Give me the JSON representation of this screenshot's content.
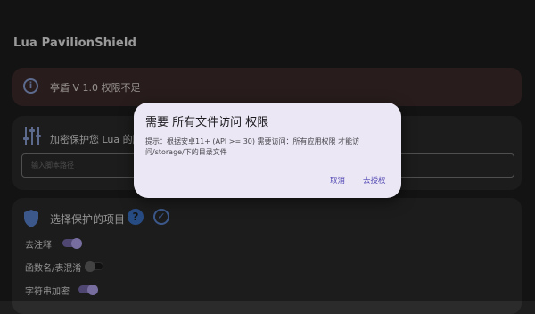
{
  "app": {
    "title": "Lua  PavilionShield"
  },
  "status": {
    "icon": "info-icon",
    "text": "亭盾  V 1.0  权限不足"
  },
  "encrypt": {
    "icon": "sliders-icon",
    "title": "加密保护您  Lua  的脚",
    "path_placeholder": "输入脚本路径"
  },
  "items": {
    "icon": "shield-icon",
    "title": "选择保护的项目",
    "options": [
      {
        "label": "去注释",
        "enabled": true
      },
      {
        "label": "函数名/表混淆",
        "enabled": false
      },
      {
        "label": "字符串加密",
        "enabled": true
      }
    ]
  },
  "dialog": {
    "title": "需要 所有文件访问 权限",
    "message": "提示：根据安卓11+ (API >= 30) 需要访问：所有应用权限 才能访问/storage/下的目录文件",
    "cancel_label": "取消",
    "grant_label": "去授权"
  },
  "colors": {
    "accent": "#4f47b5",
    "status_bg": "#3e2d2c",
    "dialog_bg": "#ece7f4"
  }
}
